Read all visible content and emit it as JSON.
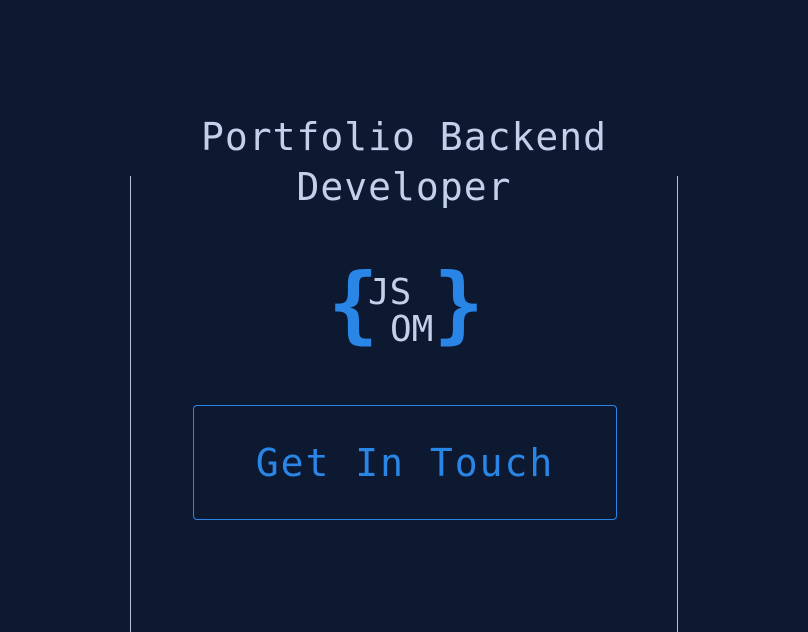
{
  "header": {
    "title": "Portfolio Backend Developer"
  },
  "logo": {
    "brace_open": "{",
    "brace_close": "}",
    "top": "JS",
    "bottom": "OM"
  },
  "cta": {
    "label": "Get In Touch"
  },
  "colors": {
    "background": "#0d1831",
    "text": "#c4d0ea",
    "accent": "#2a86e6",
    "rail": "#b7c2d8"
  }
}
